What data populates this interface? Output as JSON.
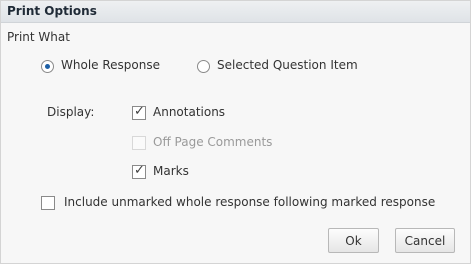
{
  "dialog": {
    "title": "Print Options",
    "print_what": {
      "label": "Print What",
      "options": [
        {
          "label": "Whole Response",
          "selected": true
        },
        {
          "label": "Selected Question Item",
          "selected": false
        }
      ]
    },
    "display": {
      "label": "Display:",
      "checkboxes": [
        {
          "label": "Annotations",
          "checked": true,
          "enabled": true
        },
        {
          "label": "Off Page Comments",
          "checked": false,
          "enabled": false
        },
        {
          "label": "Marks",
          "checked": true,
          "enabled": true
        }
      ]
    },
    "include_unmarked": {
      "label": "Include unmarked whole response following marked response",
      "checked": false
    },
    "buttons": {
      "ok": "Ok",
      "cancel": "Cancel"
    }
  }
}
